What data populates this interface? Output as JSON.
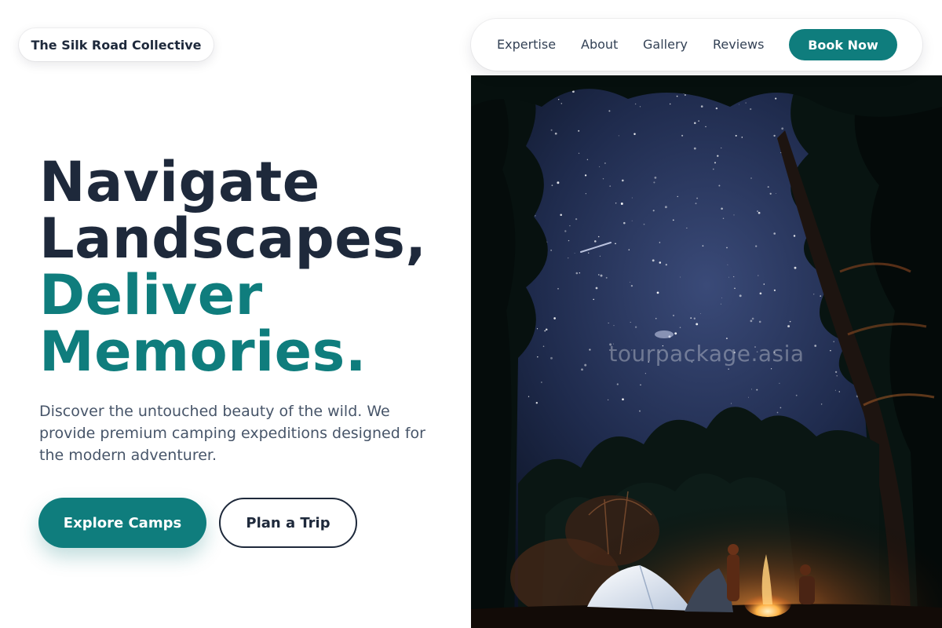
{
  "brand": {
    "name": "The Silk Road Collective"
  },
  "nav": {
    "links": [
      {
        "label": "Expertise"
      },
      {
        "label": "About"
      },
      {
        "label": "Gallery"
      },
      {
        "label": "Reviews"
      }
    ],
    "cta": "Book Now"
  },
  "hero": {
    "headline_line1": "Navigate",
    "headline_line2": "Landscapes,",
    "headline_line3": "Deliver",
    "headline_line4": "Memories.",
    "description": "Discover the untouched beauty of the wild. We provide premium camping expeditions designed for the modern adventurer.",
    "primary_cta": "Explore Camps",
    "secondary_cta": "Plan a Trip",
    "image": {
      "watermark": "tourpackage.asia"
    }
  },
  "colors": {
    "accent": "#0f7d7d",
    "text_dark": "#1e293b",
    "text_muted": "#475569",
    "night_sky": "#1f2b4d"
  }
}
